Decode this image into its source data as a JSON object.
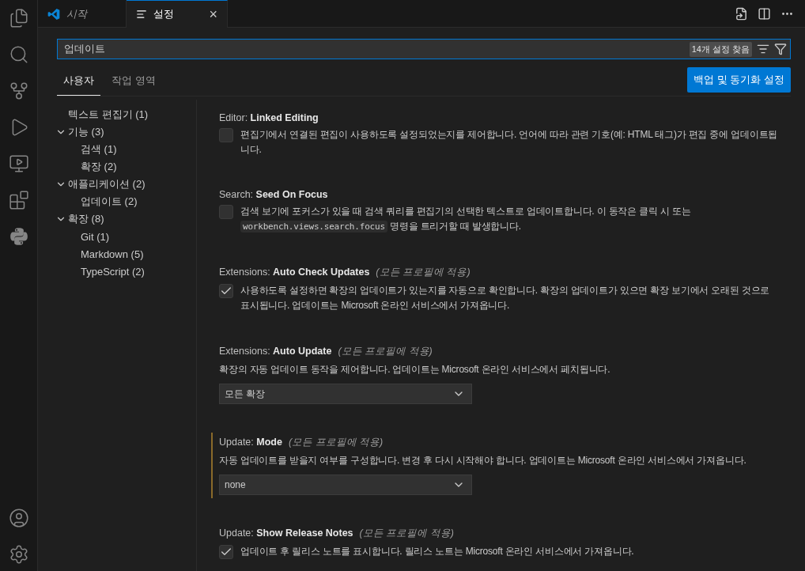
{
  "editor_tabs": [
    {
      "label": "시작",
      "kind": "welcome",
      "preview": true,
      "selected": false
    },
    {
      "label": "설정",
      "kind": "settings",
      "preview": false,
      "selected": true,
      "close": "×"
    }
  ],
  "search": {
    "value": "업데이트",
    "result_count": "14개 설정 찾음"
  },
  "scope_tabs": [
    {
      "label": "사용자",
      "selected": true
    },
    {
      "label": "작업 영역",
      "selected": false
    }
  ],
  "sync_button": "백업 및 동기화 설정",
  "toc": [
    {
      "label": "텍스트 편집기 (1)"
    },
    {
      "label": "기능 (3)",
      "expanded": true,
      "children": [
        {
          "label": "검색 (1)"
        },
        {
          "label": "확장 (2)"
        }
      ]
    },
    {
      "label": "애플리케이션 (2)",
      "expanded": true,
      "children": [
        {
          "label": "업데이트 (2)"
        }
      ]
    },
    {
      "label": "확장 (8)",
      "expanded": true,
      "children": [
        {
          "label": "Git (1)"
        },
        {
          "label": "Markdown (5)"
        },
        {
          "label": "TypeScript (2)"
        }
      ]
    }
  ],
  "settings": [
    {
      "kind": "checkbox",
      "category": "Editor: ",
      "name": "Linked Editing",
      "focused": false,
      "checked": false,
      "description": [
        {
          "kind": "text",
          "text": "편집기에서 연결된 편집이 사용하도록 설정되었는지를 제어합니다. 언어에 따라 관련 기호(예: HTML 태그)가 편집 중에 업데이트됩니다."
        }
      ]
    },
    {
      "kind": "checkbox",
      "category": "Search: ",
      "name": "Seed On Focus",
      "focused": false,
      "checked": false,
      "description": [
        {
          "kind": "text",
          "text": "검색 보기에 포커스가 있을 때 검색 쿼리를 편집기의 선택한 텍스트로 업데이트합니다. 이 동작은 클릭 시 또는 "
        },
        {
          "kind": "code",
          "text": "workbench.views.search.focus"
        },
        {
          "kind": "text",
          "text": " 명령을 트리거할 때 발생합니다."
        }
      ]
    },
    {
      "kind": "checkbox",
      "category": "Extensions: ",
      "name": "Auto Check Updates",
      "scope": "(모든 프로필에 적용)",
      "focused": false,
      "checked": true,
      "description": [
        {
          "kind": "text",
          "text": "사용하도록 설정하면 확장의 업데이트가 있는지를 자동으로 확인합니다. 확장의 업데이트가 있으면 확장 보기에서 오래된 것으로 표시됩니다. 업데이트는 Microsoft 온라인 서비스에서 가져옵니다."
        }
      ]
    },
    {
      "kind": "dropdown",
      "category": "Extensions: ",
      "name": "Auto Update",
      "scope": "(모든 프로필에 적용)",
      "focused": false,
      "value": "모든 확장",
      "description": [
        {
          "kind": "text",
          "text": "확장의 자동 업데이트 동작을 제어합니다. 업데이트는 Microsoft 온라인 서비스에서 페치됩니다."
        }
      ]
    },
    {
      "kind": "dropdown",
      "category": "Update: ",
      "name": "Mode",
      "scope": "(모든 프로필에 적용)",
      "focused": true,
      "value": "none",
      "description": [
        {
          "kind": "text",
          "text": "자동 업데이트를 받을지 여부를 구성합니다. 변경 후 다시 시작해야 합니다. 업데이트는 Microsoft 온라인 서비스에서 가져옵니다."
        }
      ]
    },
    {
      "kind": "checkbox",
      "category": "Update: ",
      "name": "Show Release Notes",
      "scope": "(모든 프로필에 적용)",
      "focused": false,
      "checked": true,
      "description": [
        {
          "kind": "text",
          "text": "업데이트 후 릴리스 노트를 표시합니다. 릴리스 노트는 Microsoft 온라인 서비스에서 가져옵니다."
        }
      ]
    }
  ]
}
